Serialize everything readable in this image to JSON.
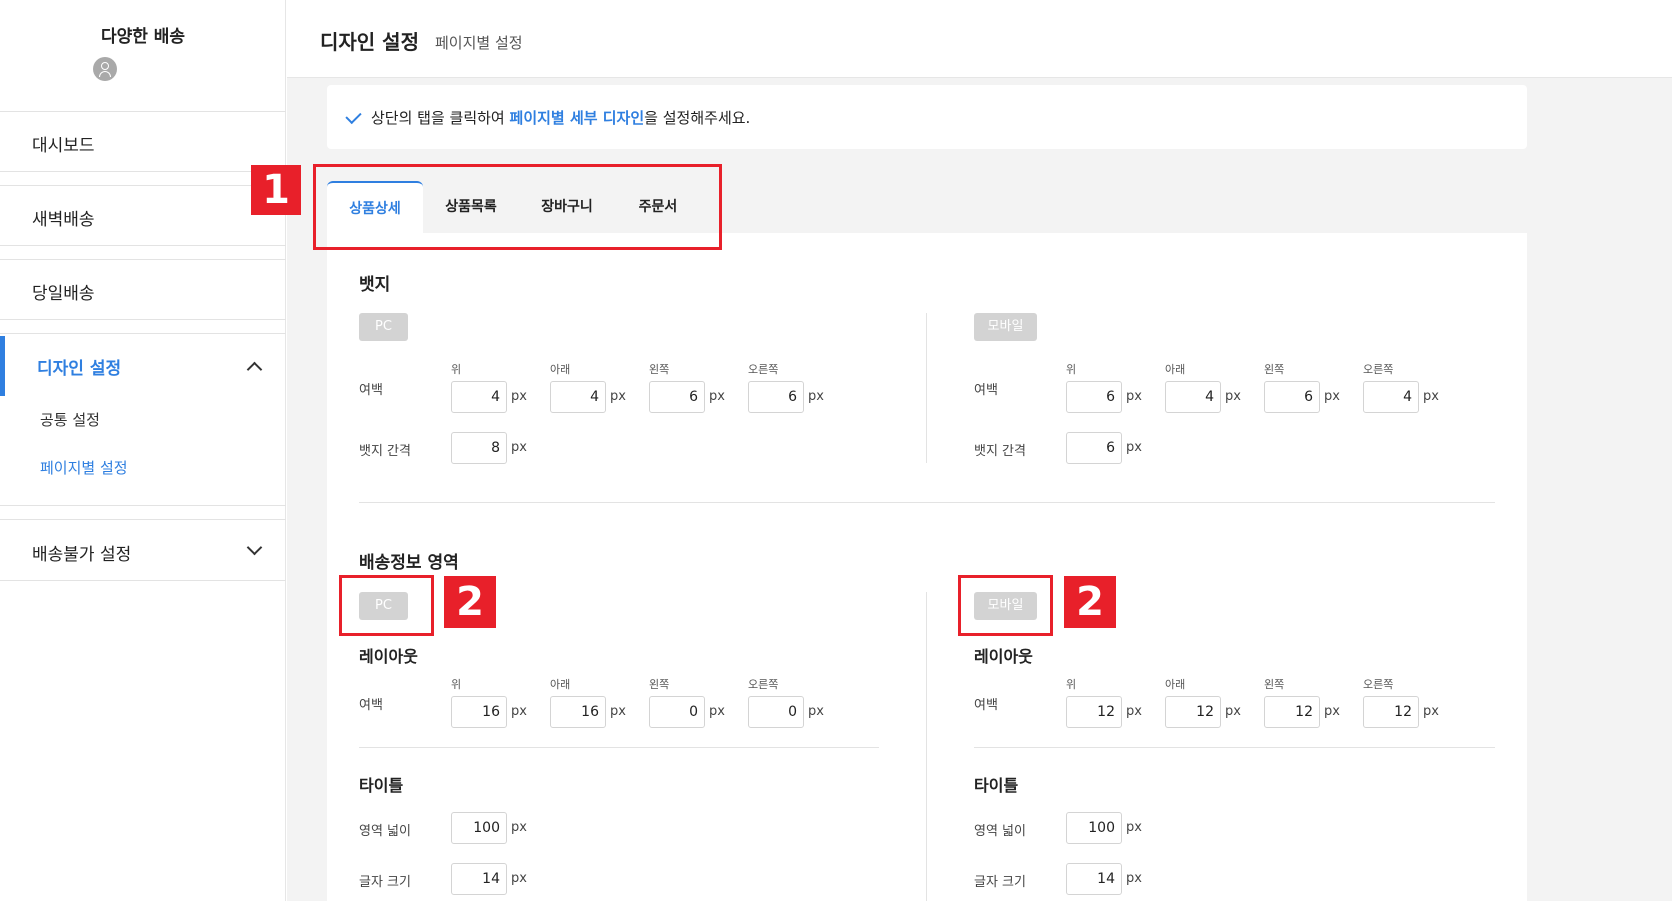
{
  "sidebar": {
    "brand": "다양한 배송",
    "items": [
      {
        "label": "대시보드"
      },
      {
        "label": "새벽배송"
      },
      {
        "label": "당일배송"
      },
      {
        "label": "디자인 설정"
      },
      {
        "label": "배송불가 설정"
      }
    ],
    "sub_items": [
      {
        "label": "공통 설정"
      },
      {
        "label": "페이지별 설정"
      }
    ]
  },
  "header": {
    "title": "디자인 설정",
    "subtitle": "페이지별 설정"
  },
  "notice": {
    "prefix": "상단의 탭을 클릭하여 ",
    "highlight": "페이지별 세부 디자인",
    "suffix": "을 설정해주세요."
  },
  "tabs": [
    {
      "label": "상품상세",
      "active": true
    },
    {
      "label": "상품목록"
    },
    {
      "label": "장바구니"
    },
    {
      "label": "주문서"
    }
  ],
  "labels": {
    "badge_section": "뱃지",
    "delivery_section": "배송정보 영역",
    "pc": "PC",
    "mobile": "모바일",
    "margin": "여백",
    "badge_gap": "뱃지 간격",
    "layout": "레이아웃",
    "title": "타이틀",
    "area_width": "영역 넓이",
    "font_size": "글자 크기",
    "unit": "px",
    "top": "위",
    "bottom": "아래",
    "left": "왼쪽",
    "right": "오른쪽"
  },
  "values": {
    "badge_pc_margin": [
      "4",
      "4",
      "6",
      "6"
    ],
    "badge_pc_gap": "8",
    "badge_mobile_margin": [
      "6",
      "4",
      "6",
      "4"
    ],
    "badge_mobile_gap": "6",
    "delivery_pc_margin": [
      "16",
      "16",
      "0",
      "0"
    ],
    "delivery_pc_area_width": "100",
    "delivery_pc_font_size": "14",
    "delivery_mobile_margin": [
      "12",
      "12",
      "12",
      "12"
    ],
    "delivery_mobile_area_width": "100",
    "delivery_mobile_font_size": "14"
  },
  "annotations": {
    "one": "1",
    "two": "2"
  },
  "colors": {
    "accent": "#2f7fe0",
    "annotation": "#e8202a"
  }
}
